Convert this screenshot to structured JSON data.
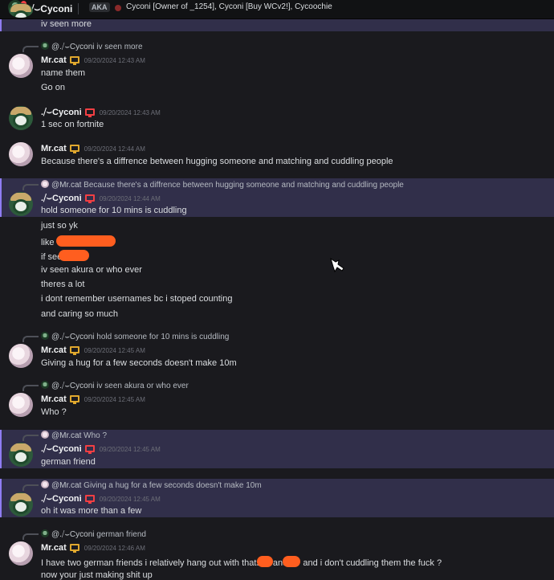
{
  "header": {
    "name": ".⧸⌣Cyconi",
    "aka_label": "AKA",
    "aka_names": "Cyconi [Owner of _1254], Cyconi [Buy WCv2!], Cycoochie"
  },
  "messages": [
    {
      "type": "text",
      "text": "iv seen more"
    },
    {
      "type": "group",
      "reply": {
        "name": "@.⧸⌣Cyconi",
        "text": "iv seen more"
      },
      "author": "Mr.cat",
      "time": "09/20/2024 12:43 AM",
      "lines": [
        "name them",
        "Go on"
      ]
    },
    {
      "type": "group",
      "author": ".⧸⌣Cyconi",
      "time": "09/20/2024 12:43 AM",
      "lines": [
        "1 sec on fortnite"
      ]
    },
    {
      "type": "group",
      "author": "Mr.cat",
      "time": "09/20/2024 12:44 AM",
      "lines": [
        "Because there's a diffrence between hugging someone and matching and cuddling people"
      ]
    },
    {
      "type": "group",
      "reply": {
        "name": "@Mr.cat",
        "text": "Because there's a diffrence between hugging someone and matching and cuddling people"
      },
      "author": ".⧸⌣Cyconi",
      "time": "09/20/2024 12:44 AM",
      "lines": [
        "hold someone for 10 mins is cuddling",
        "just so yk",
        "like",
        "if seen",
        "iv seen akura or who ever",
        "theres a lot",
        "i dont remember usernames bc i stoped counting",
        "and caring so much"
      ]
    },
    {
      "type": "group",
      "reply": {
        "name": "@.⧸⌣Cyconi",
        "text": "hold someone for 10 mins is cuddling"
      },
      "author": "Mr.cat",
      "time": "09/20/2024 12:45 AM",
      "lines": [
        "Giving  a hug for a few seconds doesn't make 10m"
      ]
    },
    {
      "type": "group",
      "reply": {
        "name": "@.⧸⌣Cyconi",
        "text": "iv seen akura or who ever"
      },
      "author": "Mr.cat",
      "time": "09/20/2024 12:45 AM",
      "lines": [
        "Who ?"
      ]
    },
    {
      "type": "group",
      "reply": {
        "name": "@Mr.cat",
        "text": "Who ?"
      },
      "author": ".⧸⌣Cyconi",
      "time": "09/20/2024 12:45 AM",
      "lines": [
        "german friend"
      ]
    },
    {
      "type": "group",
      "reply": {
        "name": "@Mr.cat",
        "text": "Giving  a hug for a few seconds doesn't make 10m"
      },
      "author": ".⧸⌣Cyconi",
      "time": "09/20/2024 12:45 AM",
      "lines": [
        "oh it was more than a few"
      ]
    },
    {
      "type": "group",
      "reply": {
        "name": "@.⧸⌣Cyconi",
        "text": "german friend"
      },
      "author": "Mr.cat",
      "time": "09/20/2024 12:46 AM",
      "lines": [
        "I have two german friends i relatively hang out with thats",
        "and",
        "and i don't cuddling them the fuck ?",
        "now your just making shit up"
      ]
    }
  ],
  "colors": {
    "accent": "#8f7cf2",
    "highlight": "#312f4a",
    "redaction": "#ff5e1f",
    "mobile_icon": "#e0a82e",
    "desktop_icon": "#f23f43"
  },
  "icons": [
    "desktop-icon",
    "mobile-icon",
    "cursor-icon"
  ]
}
